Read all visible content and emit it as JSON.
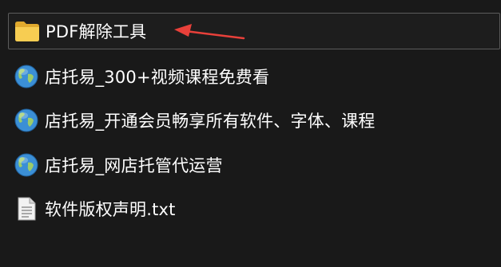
{
  "files": [
    {
      "name": "PDF解除工具",
      "type": "folder",
      "icon": "folder-icon",
      "selected": true
    },
    {
      "name": "店托易_300+视频课程免费看",
      "type": "internet-shortcut",
      "icon": "globe-icon"
    },
    {
      "name": "店托易_开通会员畅享所有软件、字体、课程",
      "type": "internet-shortcut",
      "icon": "globe-icon"
    },
    {
      "name": "店托易_网店托管代运营",
      "type": "internet-shortcut",
      "icon": "globe-icon"
    },
    {
      "name": "软件版权声明.txt",
      "type": "text-file",
      "icon": "text-file-icon"
    }
  ],
  "annotation": {
    "icon": "red-arrow-icon",
    "color": "#e8403a"
  },
  "colors": {
    "background": "#191919",
    "selection_border": "#5c5c5c",
    "folder": "#f3c244",
    "text": "#ffffff"
  }
}
